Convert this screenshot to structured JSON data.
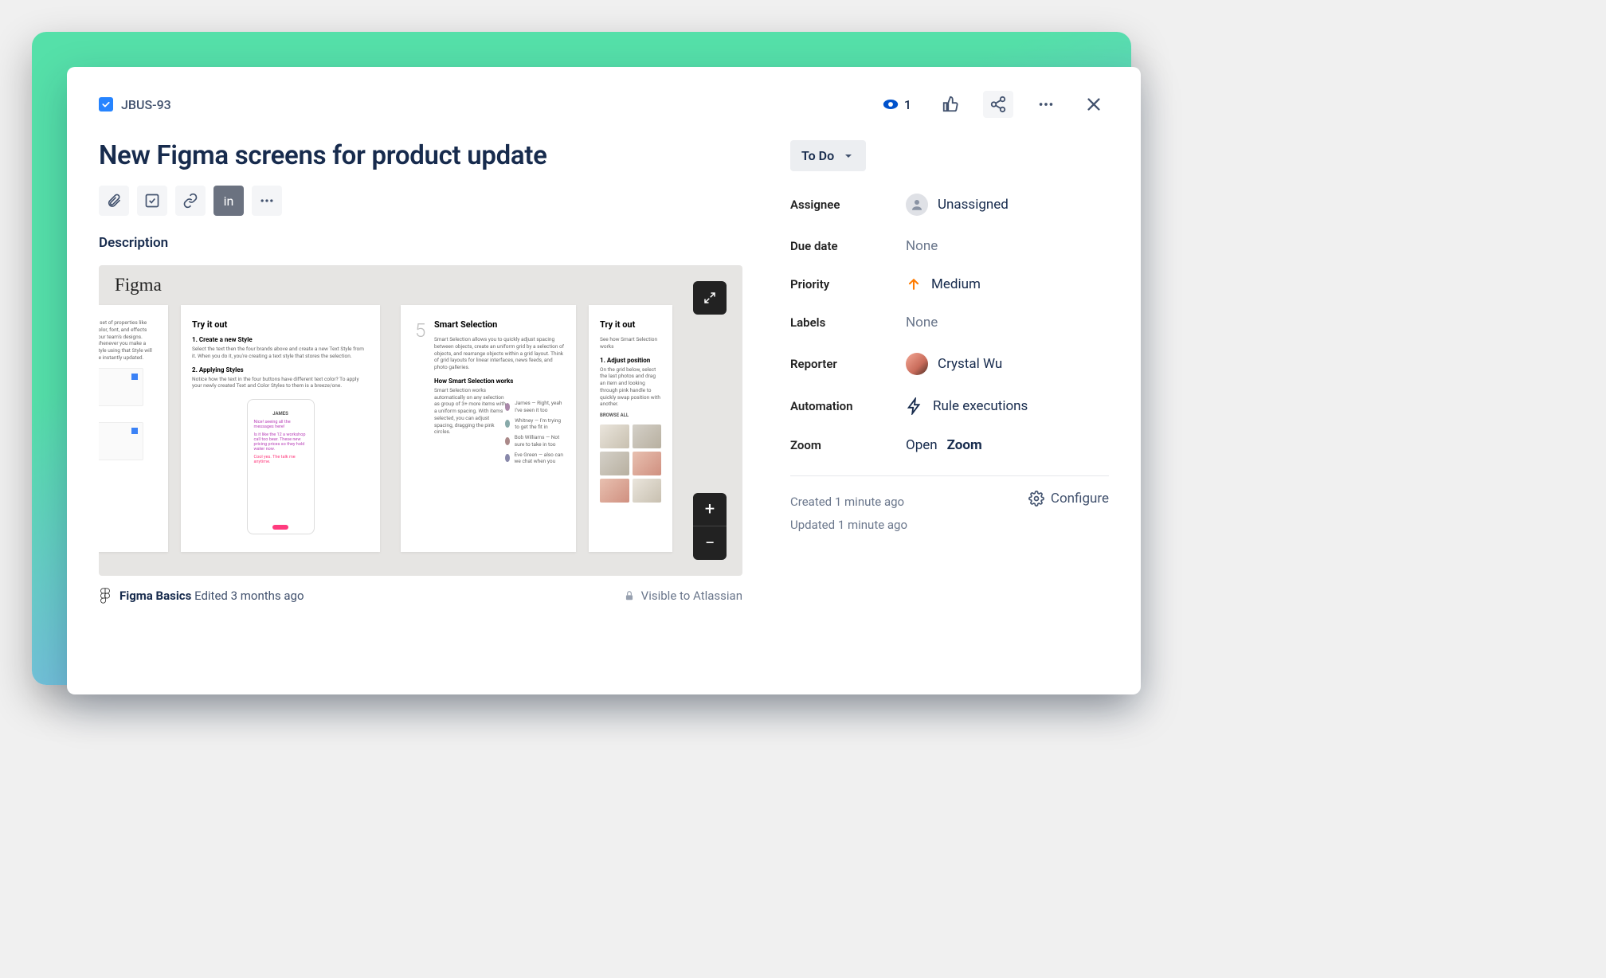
{
  "issue": {
    "key": "JBUS-93",
    "title": "New Figma screens for product update",
    "status": "To Do",
    "description_label": "Description"
  },
  "header": {
    "watch_count": "1"
  },
  "fields": {
    "assignee": {
      "label": "Assignee",
      "value": "Unassigned"
    },
    "duedate": {
      "label": "Due date",
      "value": "None"
    },
    "priority": {
      "label": "Priority",
      "value": "Medium"
    },
    "labels": {
      "label": "Labels",
      "value": "None"
    },
    "reporter": {
      "label": "Reporter",
      "value": "Crystal Wu"
    },
    "automation": {
      "label": "Automation",
      "value": "Rule executions"
    },
    "zoom": {
      "label": "Zoom",
      "value_prefix": "Open ",
      "value_bold": "Zoom"
    }
  },
  "meta": {
    "created": "Created 1 minute ago",
    "updated": "Updated 1 minute ago",
    "configure": "Configure"
  },
  "preview": {
    "app_name": "Figma",
    "file_name": "Figma Basics",
    "edited": "Edited 3 months ago",
    "visibility": "Visible to Atlassian",
    "frames": {
      "try_it_out": "Try it out",
      "create_style": "1. Create a new Style",
      "applying_styles": "2. Applying Styles",
      "smart_selection": "Smart Selection",
      "how_works": "How Smart Selection works",
      "adjust_position": "1. Adjust position",
      "num5": "5"
    }
  }
}
